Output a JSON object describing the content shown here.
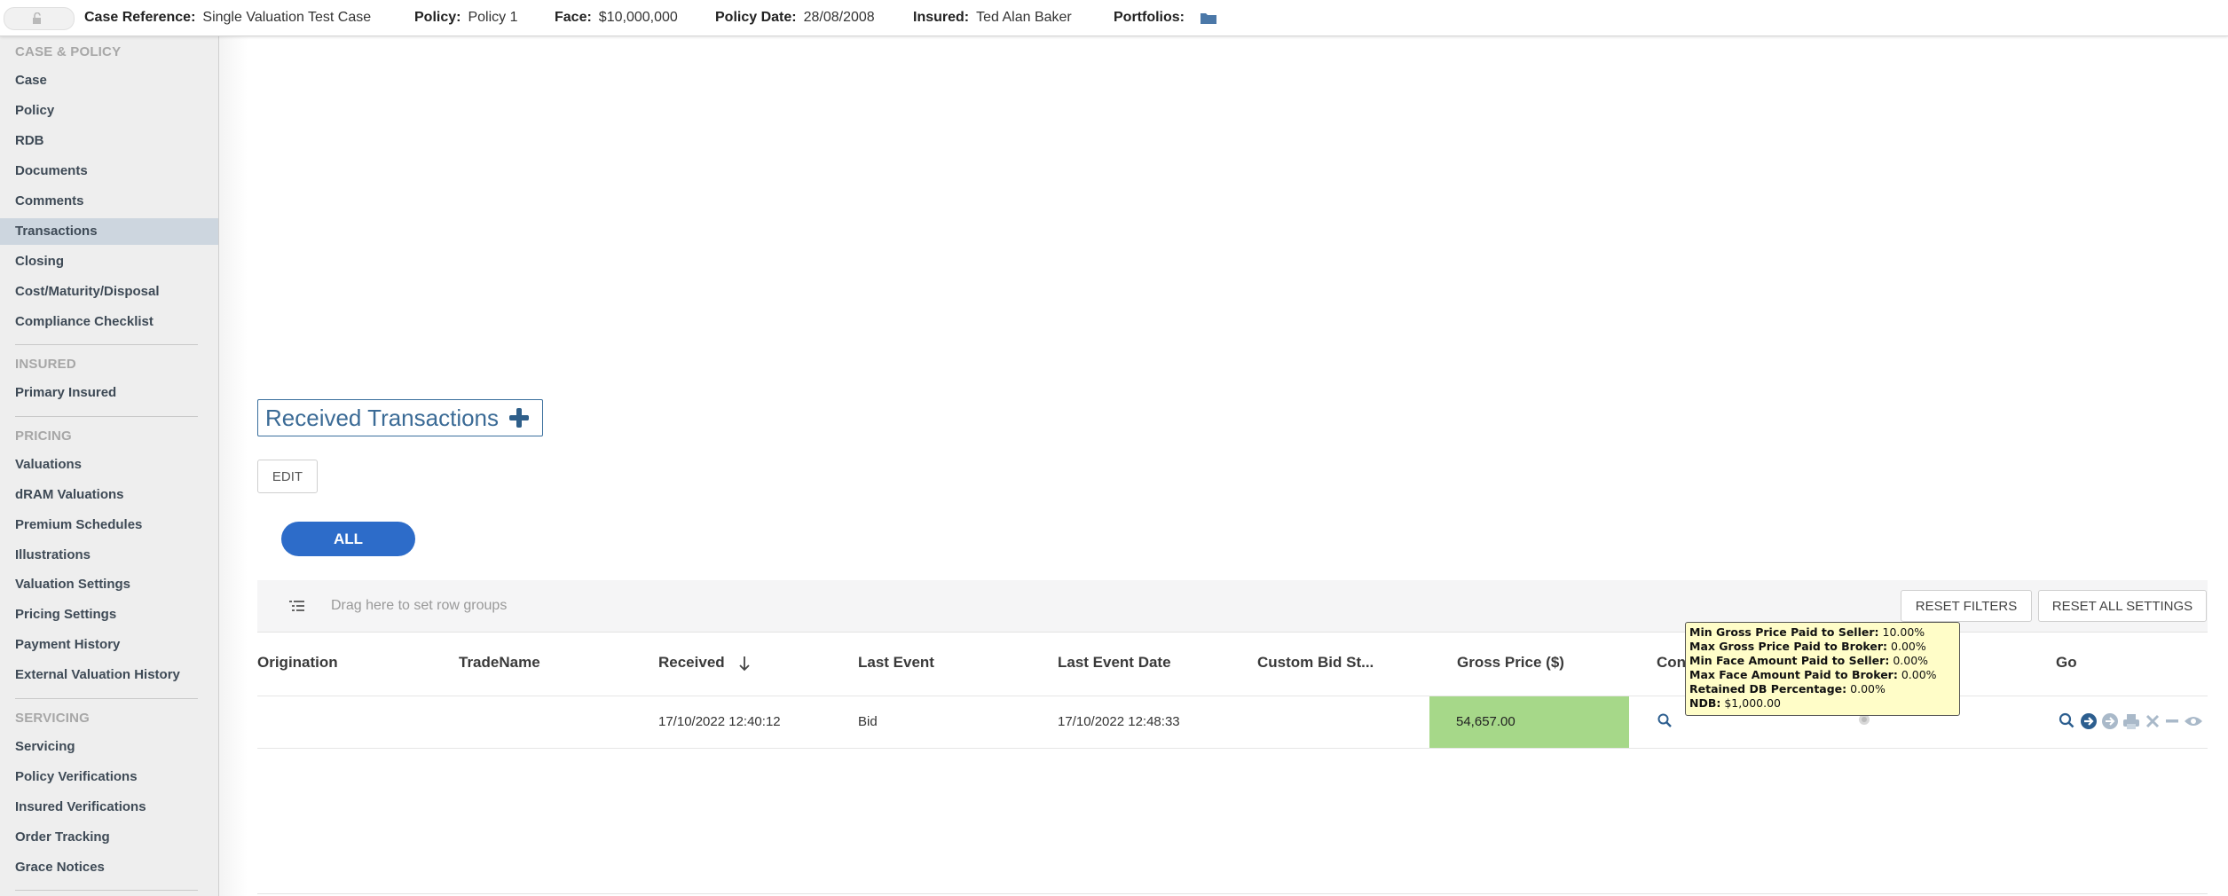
{
  "header": {
    "case_reference_label": "Case Reference:",
    "case_reference_value": "Single Valuation Test Case",
    "policy_label": "Policy:",
    "policy_value": "Policy 1",
    "face_label": "Face:",
    "face_value": "$10,000,000",
    "policy_date_label": "Policy Date:",
    "policy_date_value": "28/08/2008",
    "insured_label": "Insured:",
    "insured_value": "Ted Alan Baker",
    "portfolios_label": "Portfolios:"
  },
  "sidebar": {
    "sections": [
      {
        "title": "CASE & POLICY",
        "items": [
          "Case",
          "Policy",
          "RDB",
          "Documents",
          "Comments",
          "Transactions",
          "Closing",
          "Cost/Maturity/Disposal",
          "Compliance Checklist"
        ]
      },
      {
        "title": "INSURED",
        "items": [
          "Primary Insured"
        ]
      },
      {
        "title": "PRICING",
        "items": [
          "Valuations",
          "dRAM Valuations",
          "Premium Schedules",
          "Illustrations",
          "Valuation Settings",
          "Pricing Settings",
          "Payment History",
          "External Valuation History"
        ]
      },
      {
        "title": "SERVICING",
        "items": [
          "Servicing",
          "Policy Verifications",
          "Insured Verifications",
          "Order Tracking",
          "Grace Notices"
        ]
      }
    ],
    "active_item": "Transactions"
  },
  "main": {
    "panel_title": "Received Transactions",
    "edit_label": "EDIT",
    "filter_all_label": "ALL",
    "group_bar_text": "Drag here to set row groups",
    "reset_filters_label": "RESET FILTERS",
    "reset_all_label": "RESET ALL SETTINGS"
  },
  "grid": {
    "columns": [
      "Origination",
      "TradeName",
      "Received",
      "Last Event",
      "Last Event Date",
      "Custom Bid St...",
      "Gross Price ($)",
      "Con",
      "Go"
    ],
    "rows": [
      {
        "origination": "",
        "trade_name": "",
        "received": "17/10/2022 12:40:12",
        "last_event": "Bid",
        "last_event_date": "17/10/2022 12:48:33",
        "custom_bid_status": "",
        "gross_price": "54,657.00"
      }
    ],
    "sorted_column": "Received",
    "highlight_color": "#a6d889"
  },
  "tooltip": {
    "lines": [
      {
        "label": "Min Gross Price Paid to Seller:",
        "value": "10.00%"
      },
      {
        "label": "Max Gross Price Paid to Broker:",
        "value": "0.00%"
      },
      {
        "label": "Min Face Amount Paid to Seller:",
        "value": "0.00%"
      },
      {
        "label": "Max Face Amount Paid to Broker:",
        "value": "0.00%"
      },
      {
        "label": "Retained DB Percentage:",
        "value": "0.00%"
      },
      {
        "label": "NDB:",
        "value": "$1,000.00"
      }
    ]
  },
  "icons": [
    "lock-icon",
    "folder-icon",
    "plus-icon",
    "row-group-icon",
    "sort-desc-icon",
    "magnifier-icon",
    "eye-icon",
    "view-icon",
    "go-arrow-icon",
    "circle-arrow-icon",
    "print-icon",
    "delete-icon",
    "minus-icon",
    "eye-toggle-icon"
  ]
}
